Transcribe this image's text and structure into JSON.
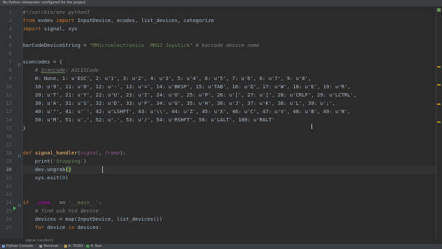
{
  "notification": {
    "message": "No Python interpreter configured for the project",
    "link": ""
  },
  "code": {
    "line_numbers": [
      "1",
      "2",
      "3",
      "4",
      "5",
      "6",
      "7",
      "8",
      "9",
      "10",
      "11",
      "12",
      "13",
      "14",
      "15",
      "16",
      "17",
      "18",
      "19",
      "20",
      "21",
      "22",
      "23",
      "24",
      "25",
      "26",
      "27"
    ],
    "current_line": "20",
    "lines": {
      "l1": "#!/usr/bin/env python3",
      "l2_kw1": "from",
      "l2_mod": " evdev ",
      "l2_kw2": "import",
      "l2_rest": " InputDevice, ecodes, list_devices, categorize",
      "l3_kw": "import",
      "l3_rest": " signal, sys",
      "l5_var": "barCodeDeviceString = ",
      "l5_str": "\"MMicroelectronics  MM32 Joystick\"",
      "l5_cm": " # barcode device name",
      "l7": "scancodes = {",
      "l8_a": "    # ",
      "l8_b": "Scancode",
      "l8_c": ": ASCIICode",
      "l9": "    0: None, 1: u'ESC', 2: u'1', 3: u'2', 4: u'3', 5: u'4', 6: u'5', 7: u'6', 8: u'7', 9: u'8',",
      "l10": "    10: u'9', 11: u'0', 12: u'-', 13: u'=', 14: u'BKSP', 15: u'TAB', 16: u'Q', 17: u'W', 18: u'E', 19: u'R',",
      "l11": "    20: u'T', 21: u'Y', 22: u'U', 23: u'I', 24: u'O', 25: u'P', 26: u'[', 27: u']', 28: u'CRLF', 29: u'LCTRL',",
      "l12": "    30: u'A', 31: u'S', 32: u'D', 33: u'F', 34: u'G', 35: u'H', 36: u'J', 37: u'K', 38: u'L', 39: u';',",
      "l13": "    40: u'\"', 41: u'`', 42: u'LSHFT', 43: u'\\\\', 44: u'Z', 45: u'X', 46: u'C', 47: u'V', 48: u'B', 49: u'N',",
      "l14": "    50: u'M', 51: u',', 52: u'.', 53: u'/', 54: u'RSHFT', 56: u'LALT', 100: u'RALT'",
      "l15": "}",
      "l18_kw": "def ",
      "l18_fn": "signal_handler",
      "l18_p1": "(",
      "l18_a1": "signal",
      "l18_p2": ", ",
      "l18_a2": "frame",
      "l18_p3": "):",
      "l19_a": "    print(",
      "l19_s": "'Stopping'",
      "l19_b": ")",
      "l20_a": "    dev.ungrab",
      "l20_b": "()",
      "l21_a": "    sys.exit(",
      "l21_n": "0",
      "l21_b": ")",
      "l24_kw": "if ",
      "l24_d1": "__name__",
      "l24_m": " == ",
      "l24_s": "'__main__'",
      "l24_e": ":",
      "l25": "    # find usb hid device",
      "l26": "    devices = map(InputDevice, list_devices())",
      "l27_kw1": "    for",
      "l27_mid": " device ",
      "l27_kw2": "in",
      "l27_rest": " devices:"
    }
  },
  "breadcrumb": "signal_handler()",
  "status_tools": [
    "Python Console",
    "Terminal",
    "6: TODO",
    "4: Run"
  ],
  "colors": {
    "background": "#2b2b2b",
    "keyword": "#cc7832",
    "string": "#6a8759",
    "number": "#6897bb",
    "comment": "#808080",
    "function": "#ffc66d"
  },
  "icons": [
    "run-arrow-icon",
    "fold-icon"
  ]
}
